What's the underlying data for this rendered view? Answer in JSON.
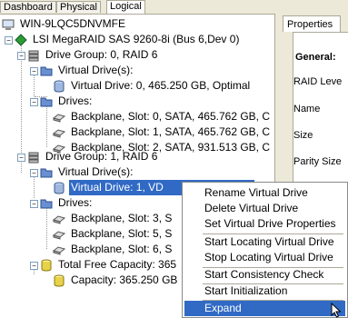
{
  "tabs": [
    {
      "label": "Dashboard"
    },
    {
      "label": "Physical"
    },
    {
      "label": "Logical"
    }
  ],
  "tree": {
    "server": "WIN-9LQC5DNVMFE",
    "controller": "LSI MegaRAID SAS 9260-8i (Bus 6,Dev 0)",
    "group0": {
      "label": "Drive Group: 0, RAID  6",
      "vd_folder": "Virtual Drive(s):",
      "vd": "Virtual Drive: 0, 465.250 GB, Optimal",
      "drives_folder": "Drives:",
      "drives": [
        "Backplane, Slot: 0, SATA, 465.762 GB, C",
        "Backplane, Slot: 1, SATA, 465.762 GB, C",
        "Backplane, Slot: 2, SATA, 931.513 GB, C"
      ]
    },
    "group1": {
      "label": "Drive Group: 1, RAID  6",
      "vd_folder": "Virtual Drive(s):",
      "vd": "Virtual Drive: 1, VD",
      "drives_folder": "Drives:",
      "drives": [
        "Backplane, Slot: 3, S",
        "Backplane, Slot: 5, S",
        "Backplane, Slot: 6, S"
      ]
    },
    "free": {
      "label": "Total Free Capacity: 365",
      "capacity": "Capacity: 365.250 GB"
    }
  },
  "properties": {
    "tab": "Properties",
    "heading": "General:",
    "fields": [
      "RAID Leve",
      "Name",
      "Size",
      "Parity Size"
    ]
  },
  "context_menu": {
    "items": [
      {
        "label": "Rename Virtual Drive"
      },
      {
        "label": "Delete Virtual Drive"
      },
      {
        "label": "Set Virtual Drive Properties"
      },
      {
        "label": "Start Locating Virtual Drive"
      },
      {
        "label": "Stop Locating Virtual Drive"
      },
      {
        "label": "Start Consistency Check"
      },
      {
        "label": "Start Initialization"
      },
      {
        "label": "Expand"
      }
    ],
    "highlighted": "Expand"
  },
  "colors": {
    "selection": "#316ac5",
    "chrome": "#ece9d8"
  },
  "icons": {
    "expand_collapse": "minus-box-icon",
    "server": "computer-icon",
    "controller": "green-diamond-icon",
    "drive_group": "drive-stack-icon",
    "folder": "folder-icon",
    "virtual_drive": "cylinder-disk-icon",
    "physical_drive": "hard-disk-icon",
    "free_capacity": "yellow-cylinder-icon"
  }
}
